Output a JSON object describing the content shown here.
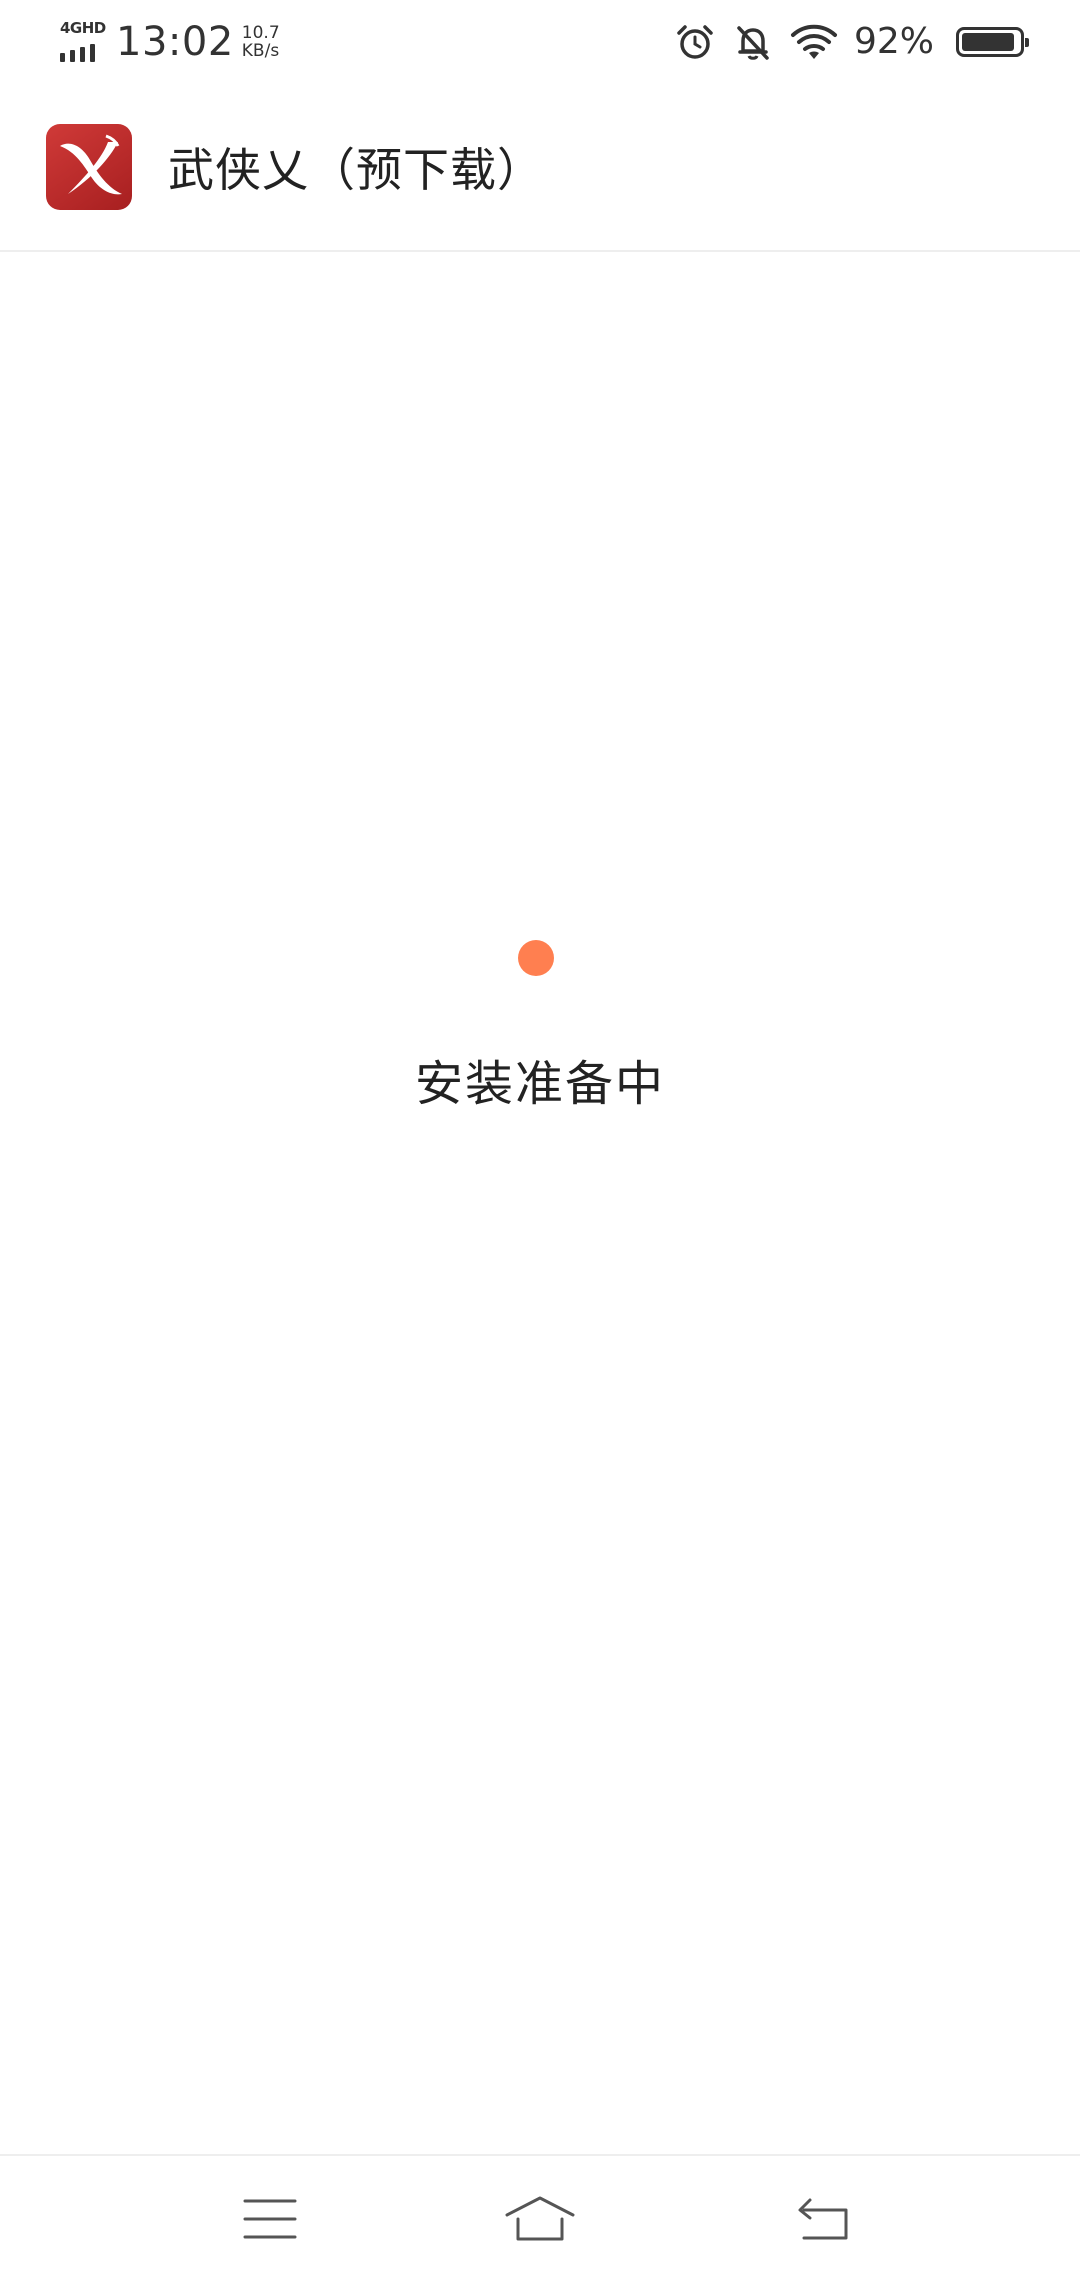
{
  "status_bar": {
    "network_type": "4GHD",
    "time": "13:02",
    "net_speed_value": "10.7",
    "net_speed_unit": "KB/s",
    "battery_percent_text": "92%",
    "battery_level": 0.92,
    "icons": [
      "signal-icon",
      "alarm-icon",
      "bell-muted-icon",
      "wifi-icon",
      "battery-icon"
    ]
  },
  "header": {
    "app_name": "武侠乂（预下载）",
    "app_icon": "wuxia-app-icon"
  },
  "main": {
    "loading_text": "安装准备中",
    "loading_indicator_color": "#ff7f50"
  },
  "nav_bar": {
    "buttons": [
      "menu-icon",
      "home-icon",
      "back-icon"
    ]
  },
  "colors": {
    "accent": "#ff7f50",
    "app_icon_red": "#b82a28",
    "text": "#222222",
    "divider": "#eeeeee"
  }
}
